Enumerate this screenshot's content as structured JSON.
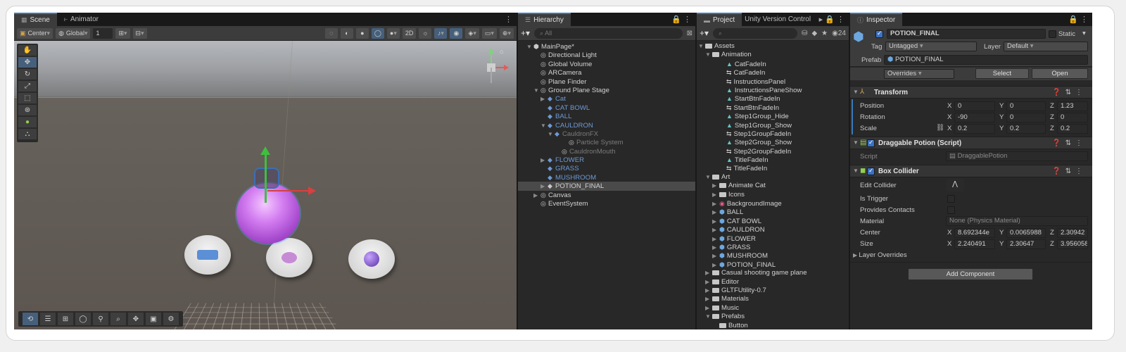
{
  "scene": {
    "tabs": [
      {
        "label": "Scene",
        "icon": "grid-icon"
      },
      {
        "label": "Animator",
        "icon": "animator-icon"
      }
    ],
    "toolbar": {
      "pivot": "Center",
      "space": "Global",
      "grid_value": "1"
    },
    "tools": [
      "hand",
      "move",
      "rotate",
      "scale",
      "rect",
      "transform",
      "custom",
      "pivot"
    ]
  },
  "hierarchy": {
    "tab": "Hierarchy",
    "search_placeholder": "All",
    "rows": [
      {
        "label": "MainPage*",
        "indent": 1,
        "arrow": "▼",
        "icon": "⬢",
        "style": ""
      },
      {
        "label": "Directional Light",
        "indent": 2,
        "arrow": "",
        "icon": "◎",
        "style": ""
      },
      {
        "label": "Global Volume",
        "indent": 2,
        "arrow": "",
        "icon": "◎",
        "style": ""
      },
      {
        "label": "ARCamera",
        "indent": 2,
        "arrow": "",
        "icon": "◎",
        "style": ""
      },
      {
        "label": "Plane Finder",
        "indent": 2,
        "arrow": "",
        "icon": "◎",
        "style": ""
      },
      {
        "label": "Ground Plane Stage",
        "indent": 2,
        "arrow": "▼",
        "icon": "◎",
        "style": ""
      },
      {
        "label": "Cat",
        "indent": 3,
        "arrow": "▶",
        "icon": "◆",
        "style": "blue"
      },
      {
        "label": "CAT BOWL",
        "indent": 3,
        "arrow": "",
        "icon": "◆",
        "style": "blue"
      },
      {
        "label": "BALL",
        "indent": 3,
        "arrow": "",
        "icon": "◆",
        "style": "blue"
      },
      {
        "label": "CAULDRON",
        "indent": 3,
        "arrow": "▼",
        "icon": "◆",
        "style": "blue"
      },
      {
        "label": "CauldronFX",
        "indent": 4,
        "arrow": "▼",
        "icon": "◆",
        "style": "blue dim"
      },
      {
        "label": "Particle System",
        "indent": 6,
        "arrow": "",
        "icon": "◎",
        "style": "dim"
      },
      {
        "label": "CauldronMouth",
        "indent": 5,
        "arrow": "",
        "icon": "◎",
        "style": "dim"
      },
      {
        "label": "FLOWER",
        "indent": 3,
        "arrow": "▶",
        "icon": "◆",
        "style": "blue"
      },
      {
        "label": "GRASS",
        "indent": 3,
        "arrow": "",
        "icon": "◆",
        "style": "blue"
      },
      {
        "label": "MUSHROOM",
        "indent": 3,
        "arrow": "",
        "icon": "◆",
        "style": "blue"
      },
      {
        "label": "POTION_FINAL",
        "indent": 3,
        "arrow": "▶",
        "icon": "◆",
        "style": "sel"
      },
      {
        "label": "Canvas",
        "indent": 2,
        "arrow": "▶",
        "icon": "◎",
        "style": ""
      },
      {
        "label": "EventSystem",
        "indent": 2,
        "arrow": "",
        "icon": "◎",
        "style": ""
      }
    ]
  },
  "project": {
    "tabs": [
      "Project",
      "Unity Version Control"
    ],
    "count": "24",
    "rows": [
      {
        "label": "Assets",
        "indent": 0,
        "arrow": "▼",
        "kind": "folder"
      },
      {
        "label": "Animation",
        "indent": 1,
        "arrow": "▼",
        "kind": "folder"
      },
      {
        "label": "CatFadeIn",
        "indent": 3,
        "arrow": "",
        "kind": "anim"
      },
      {
        "label": "CatFadeIn",
        "indent": 3,
        "arrow": "",
        "kind": "ctrl"
      },
      {
        "label": "InstructionsPanel",
        "indent": 3,
        "arrow": "",
        "kind": "ctrl"
      },
      {
        "label": "InstructionsPaneShow",
        "indent": 3,
        "arrow": "",
        "kind": "anim"
      },
      {
        "label": "StartBtnFadeIn",
        "indent": 3,
        "arrow": "",
        "kind": "anim"
      },
      {
        "label": "StartBtnFadeIn",
        "indent": 3,
        "arrow": "",
        "kind": "ctrl"
      },
      {
        "label": "Step1Group_Hide",
        "indent": 3,
        "arrow": "",
        "kind": "anim"
      },
      {
        "label": "Step1Group_Show",
        "indent": 3,
        "arrow": "",
        "kind": "anim"
      },
      {
        "label": "Step1GroupFadeIn",
        "indent": 3,
        "arrow": "",
        "kind": "ctrl"
      },
      {
        "label": "Step2Group_Show",
        "indent": 3,
        "arrow": "",
        "kind": "anim"
      },
      {
        "label": "Step2GroupFadeIn",
        "indent": 3,
        "arrow": "",
        "kind": "ctrl"
      },
      {
        "label": "TitleFadeIn",
        "indent": 3,
        "arrow": "",
        "kind": "anim"
      },
      {
        "label": "TitleFadeIn",
        "indent": 3,
        "arrow": "",
        "kind": "ctrl"
      },
      {
        "label": "Art",
        "indent": 1,
        "arrow": "▼",
        "kind": "folder"
      },
      {
        "label": "Animate Cat",
        "indent": 2,
        "arrow": "▶",
        "kind": "folder"
      },
      {
        "label": "Icons",
        "indent": 2,
        "arrow": "▶",
        "kind": "folder"
      },
      {
        "label": "BackgroundImage",
        "indent": 2,
        "arrow": "▶",
        "kind": "img"
      },
      {
        "label": "BALL",
        "indent": 2,
        "arrow": "▶",
        "kind": "pref"
      },
      {
        "label": "CAT BOWL",
        "indent": 2,
        "arrow": "▶",
        "kind": "pref"
      },
      {
        "label": "CAULDRON",
        "indent": 2,
        "arrow": "▶",
        "kind": "pref"
      },
      {
        "label": "FLOWER",
        "indent": 2,
        "arrow": "▶",
        "kind": "pref"
      },
      {
        "label": "GRASS",
        "indent": 2,
        "arrow": "▶",
        "kind": "pref"
      },
      {
        "label": "MUSHROOM",
        "indent": 2,
        "arrow": "▶",
        "kind": "pref"
      },
      {
        "label": "POTION_FINAL",
        "indent": 2,
        "arrow": "▶",
        "kind": "pref"
      },
      {
        "label": "Casual shooting game plane",
        "indent": 1,
        "arrow": "▶",
        "kind": "folder"
      },
      {
        "label": "Editor",
        "indent": 1,
        "arrow": "▶",
        "kind": "folder"
      },
      {
        "label": "GLTFUtility-0.7",
        "indent": 1,
        "arrow": "▶",
        "kind": "folder"
      },
      {
        "label": "Materials",
        "indent": 1,
        "arrow": "▶",
        "kind": "folder"
      },
      {
        "label": "Music",
        "indent": 1,
        "arrow": "▶",
        "kind": "folder"
      },
      {
        "label": "Prefabs",
        "indent": 1,
        "arrow": "▼",
        "kind": "folder"
      },
      {
        "label": "Button",
        "indent": 2,
        "arrow": "",
        "kind": "folder"
      }
    ]
  },
  "inspector": {
    "tab": "Inspector",
    "object_name": "POTION_FINAL",
    "static_label": "Static",
    "tag_label": "Tag",
    "tag_value": "Untagged",
    "layer_label": "Layer",
    "layer_value": "Default",
    "prefab_label": "Prefab",
    "prefab_value": "POTION_FINAL",
    "overrides": "Overrides",
    "select": "Select",
    "open": "Open",
    "transform": {
      "title": "Transform",
      "position_label": "Position",
      "position": {
        "x": "0",
        "y": "0",
        "z": "1.23"
      },
      "rotation_label": "Rotation",
      "rotation": {
        "x": "-90",
        "y": "0",
        "z": "0"
      },
      "scale_label": "Scale",
      "scale": {
        "x": "0.2",
        "y": "0.2",
        "z": "0.2"
      }
    },
    "draggable": {
      "title": "Draggable Potion (Script)",
      "script_label": "Script",
      "script_value": "DraggablePotion"
    },
    "box_collider": {
      "title": "Box Collider",
      "edit_collider": "Edit Collider",
      "is_trigger": "Is Trigger",
      "provides_contacts": "Provides Contacts",
      "material_label": "Material",
      "material_value": "None (Physics Material)",
      "center_label": "Center",
      "center": {
        "x": "8.692344e",
        "y": "0.0065988",
        "z": "2.30942"
      },
      "size_label": "Size",
      "size": {
        "x": "2.240491",
        "y": "2.30647",
        "z": "3.956058"
      },
      "layer_overrides": "Layer Overrides"
    },
    "add_component": "Add Component"
  }
}
